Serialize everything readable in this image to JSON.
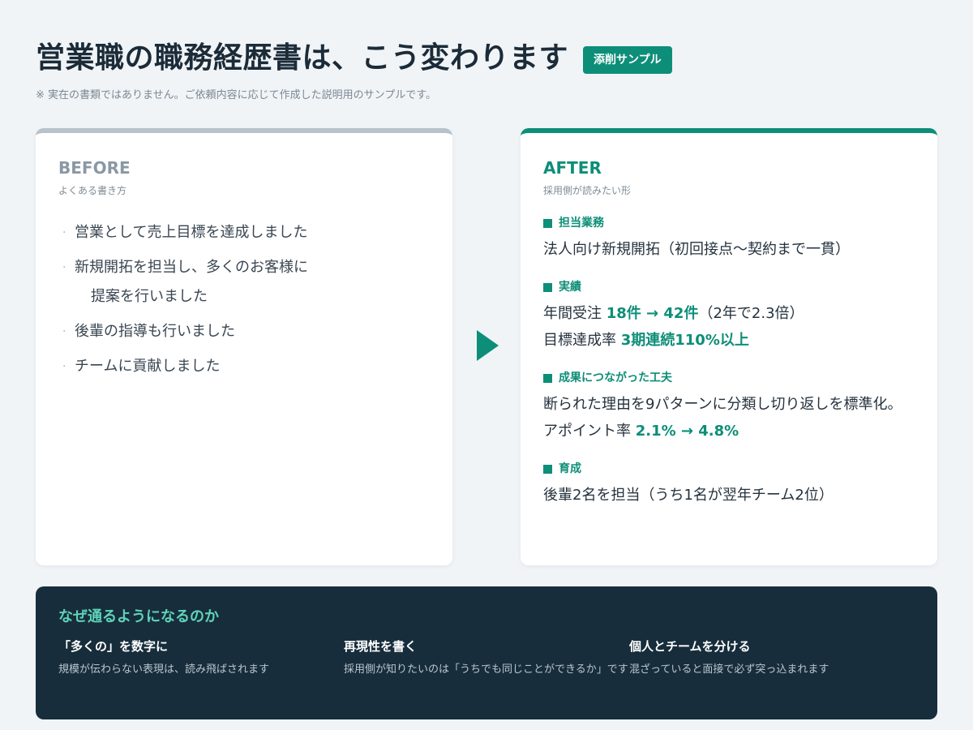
{
  "header": {
    "title": "営業職の職務経歴書は、こう変わります",
    "badge": "添削サンプル",
    "note": "※ 実在の書類ではありません。ご依頼内容に応じて作成した説明用のサンプルです。"
  },
  "before": {
    "label": "BEFORE",
    "sub": "よくある書き方",
    "items": [
      {
        "line1": "営業として売上目標を達成しました",
        "line2": ""
      },
      {
        "line1": "新規開拓を担当し、多くのお客様に",
        "line2": "提案を行いました"
      },
      {
        "line1": "後輩の指導も行いました",
        "line2": ""
      },
      {
        "line1": "チームに貢献しました",
        "line2": ""
      }
    ]
  },
  "after": {
    "label": "AFTER",
    "sub": "採用側が読みたい形",
    "sections": {
      "duty": {
        "heading": "担当業務",
        "text": "法人向け新規開拓（初回接点〜契約まで一貫）"
      },
      "results": {
        "heading": "実績",
        "orders_prefix": "年間受注 ",
        "orders_highlight": "18件 → 42件",
        "orders_suffix": "（2年で2.3倍）",
        "target_prefix": "目標達成率 ",
        "target_highlight": "3期連続110%以上"
      },
      "ideas": {
        "heading": "成果につながった工夫",
        "text": "断られた理由を9パターンに分類し切り返しを標準化。",
        "rate_prefix": "アポイント率 ",
        "rate_highlight": "2.1% → 4.8%"
      },
      "training": {
        "heading": "育成",
        "text": "後輩2名を担当（うち1名が翌年チーム2位）"
      }
    }
  },
  "panel": {
    "title": "なぜ通るようになるのか",
    "reasons": [
      {
        "title": "「多くの」を数字に",
        "desc": "規模が伝わらない表現は、読み飛ばされます"
      },
      {
        "title": "再現性を書く",
        "desc": "採用側が知りたいのは「うちでも同じことができるか」です"
      },
      {
        "title": "個人とチームを分ける",
        "desc": "混ざっていると面接で必ず突っ込まれます"
      }
    ]
  },
  "colors": {
    "accent": "#0d8e78",
    "background": "#f1f4f7",
    "panel": "#172d3b",
    "panel_title": "#5fd3b8",
    "before_border": "#b7c2ca"
  }
}
